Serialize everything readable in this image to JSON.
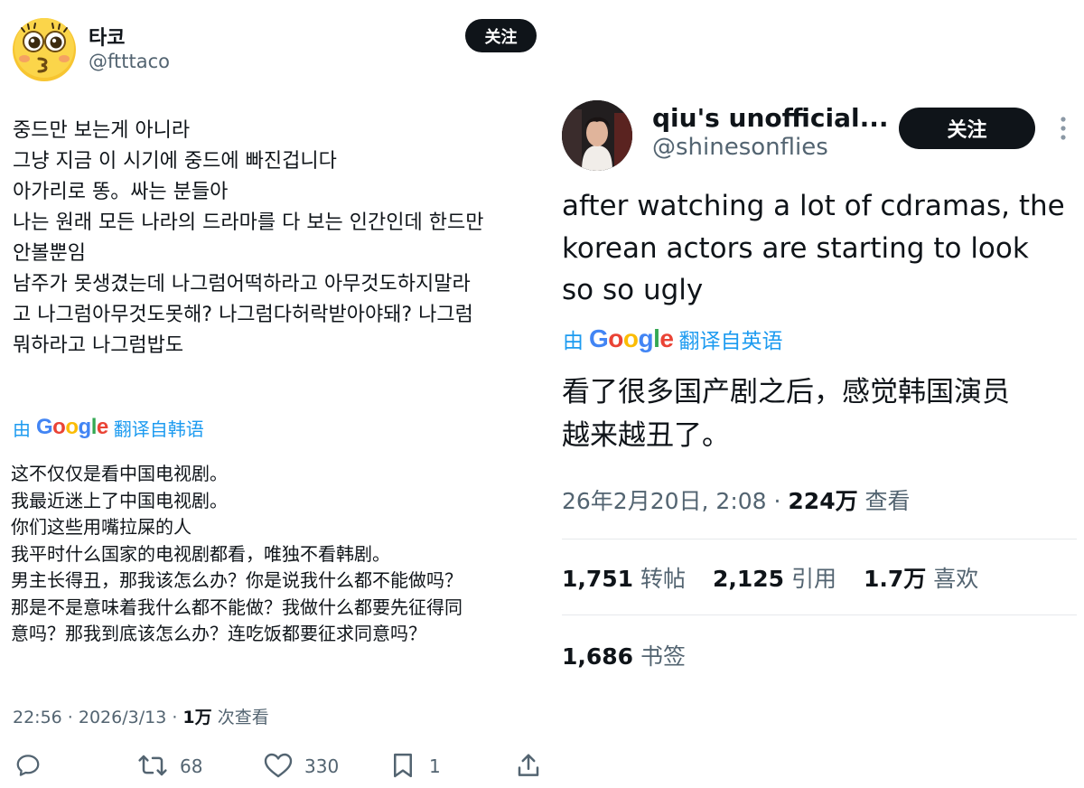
{
  "left_tweet": {
    "display_name": "타코",
    "handle": "@ftttaco",
    "follow_label": "关注",
    "body_lines": [
      "중드만 보는게 아니라",
      "그냥 지금 이 시기에 중드에 빠진겁니다",
      "아가리로 똥。싸는 분들아",
      "나는 원래 모든 나라의 드라마를 다 보는 인간인데 한드만",
      "안볼뿐임",
      "남주가 못생겼는데 나그럼어떡하라고 아무것도하지말라",
      "고 나그럼아무것도못해? 나그럼다허락받아야돼? 나그럼",
      "뭐하라고 나그럼밥도"
    ],
    "translate_prefix": "由",
    "translate_brand": "Google",
    "translate_suffix": "翻译自韩语",
    "translated_lines": [
      "这不仅仅是看中国电视剧。",
      "我最近迷上了中国电视剧。",
      "你们这些用嘴拉屎的人",
      "我平时什么国家的电视剧都看，唯独不看韩剧。",
      "男主长得丑，那我该怎么办？你是说我什么都不能做吗？",
      "那是不是意味着我什么都不能做？我做什么都要先征得同",
      "意吗？那我到底该怎么办？连吃饭都要征求同意吗？"
    ],
    "meta_time": "22:56 · 2026/3/13 · ",
    "meta_views": "1万",
    "meta_views_label": " 次查看",
    "actions": {
      "reply_icon": "reply-icon",
      "retweet_icon": "retweet-icon",
      "retweet_count": "68",
      "like_icon": "heart-icon",
      "like_count": "330",
      "bookmark_icon": "bookmark-icon",
      "bookmark_count": "1",
      "share_icon": "share-icon"
    }
  },
  "right_tweet": {
    "display_name": "qiu's unofficial...",
    "handle": "@shinesonflies",
    "follow_label": "关注",
    "more_icon": "more-vertical-icon",
    "body_lines": [
      "after watching a lot of cdramas, the",
      "korean actors are starting to look",
      "so so ugly"
    ],
    "translate_prefix": "由",
    "translate_brand": "Google",
    "translate_suffix": "翻译自英语",
    "translated_lines": [
      "看了很多国产剧之后，感觉韩国演员",
      "越来越丑了。"
    ],
    "meta_time": "26年2月20日, 2:08 · ",
    "meta_views": "224万",
    "meta_views_label": " 查看",
    "stats": {
      "retweets_value": "1,751",
      "retweets_label": "转帖",
      "quotes_value": "2,125",
      "quotes_label": "引用",
      "likes_value": "1.7万",
      "likes_label": "喜欢",
      "bookmarks_value": "1,686",
      "bookmarks_label": "书签"
    }
  },
  "colors": {
    "text": "#0f1419",
    "muted": "#536471",
    "link": "#1d9bf0",
    "button": "#0f1419",
    "avatar_yellow": "#f7c531"
  }
}
